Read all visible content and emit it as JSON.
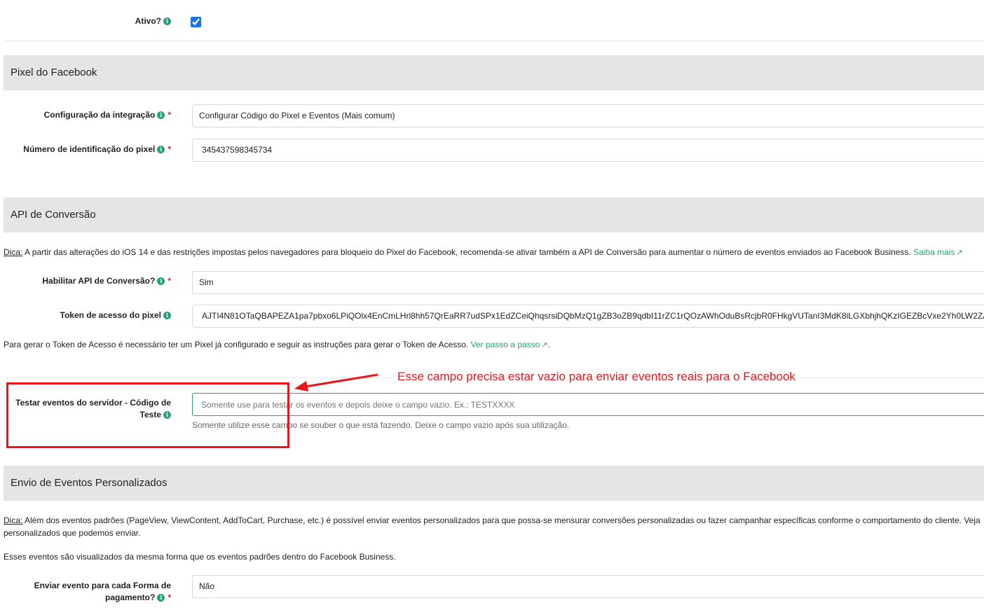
{
  "active": {
    "label": "Ativo?",
    "checked": true
  },
  "pixel_section": {
    "title": "Pixel do Facebook",
    "integration": {
      "label": "Configuração da integração",
      "value": "Configurar Código do Pixel e Eventos (Mais comum)"
    },
    "pixel_id": {
      "label": "Número de identificação do pixel",
      "value": "345437598345734"
    }
  },
  "api_section": {
    "title": "API de Conversão",
    "tip_label": "Dica:",
    "tip_text": " A partir das alterações do iOS 14 e das restrições impostas pelos navegadores para bloqueio do Pixel do Facebook, recomenda-se ativar também a API de Conversão para aumentar o número de eventos enviados ao Facebook Business. ",
    "tip_link": "Saiba mais",
    "enable": {
      "label": "Habilitar API de Conversão?",
      "value": "Sim"
    },
    "token": {
      "label": "Token de acesso do pixel",
      "value": "AJTI4N81OTaQBAPEZA1pa7pbxo6LPiQOlx4EnCmLHrl8hh57QrEaRR7udSPx1EdZCeiQhqsrsiDQbMzQ1gZB3oZB9qdbI11rZC1rQOzAWhOduBsRcjbR0FHkgVUTanI3MdK8iLGXbhjhQKzIGEZBcVxe2Yh0LW2ZA"
    },
    "token_help_text": "Para gerar o Token de Acesso é necessário ter um Pixel já configurado e seguir as instruções para gerar o Token de Acesso. ",
    "token_help_link": "Ver passo a passo",
    "token_help_end": ".",
    "test_code": {
      "label_line1": "Testar eventos do servidor - Código de",
      "label_line2": "Teste",
      "placeholder": "Somente use para testar os eventos e depois deixe o campo vazio. Ex.: TESTXXXX",
      "help": "Somente utilize esse campo se souber o que está fazendo. Deixe o campo vazio após sua utilização."
    }
  },
  "annotation": {
    "text": "Esse campo precisa estar vazio para enviar eventos reais para o Facebook",
    "color": "#e8151b"
  },
  "custom_section": {
    "title": "Envio de Eventos Personalizados",
    "tip_label": "Dica:",
    "tip_text_line1": " Além dos eventos padrões (PageView, ViewContent, AddToCart, Purchase, etc.) é possível enviar eventos personalizados para que possa-se mensurar conversões personalizadas ou fazer campanhar específicas conforme o comportamento do cliente. Veja",
    "tip_text_line2": "personalizados que podemos enviar.",
    "info_text": "Esses eventos são visualizados da mesma forma que os eventos padrões dentro do Facebook Business.",
    "payment": {
      "label_line1": "Enviar evento para cada Forma de",
      "label_line2": "pagamento?",
      "value": "Não"
    }
  },
  "colors": {
    "accent": "#27a17a",
    "required": "#d9262b",
    "section_bg": "#e5e5e5"
  }
}
